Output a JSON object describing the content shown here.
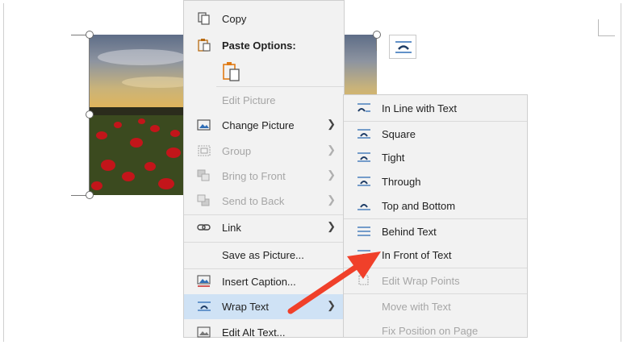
{
  "context_menu": {
    "items": [
      {
        "label": "Copy",
        "icon": "copy-icon",
        "enabled": true
      },
      {
        "label": "Paste Options:",
        "icon": "paste-icon",
        "enabled": true,
        "bold": true
      },
      {
        "label": "Edit Picture",
        "enabled": false
      },
      {
        "label": "Change Picture",
        "icon": "change-picture-icon",
        "enabled": true,
        "submenu": true
      },
      {
        "label": "Group",
        "icon": "group-icon",
        "enabled": false,
        "submenu": true
      },
      {
        "label": "Bring to Front",
        "icon": "bring-to-front-icon",
        "enabled": false,
        "submenu": true
      },
      {
        "label": "Send to Back",
        "icon": "send-to-back-icon",
        "enabled": false,
        "submenu": true
      },
      {
        "label": "Link",
        "icon": "link-icon",
        "enabled": true,
        "submenu": true
      },
      {
        "label": "Save as Picture...",
        "enabled": true
      },
      {
        "label": "Insert Caption...",
        "icon": "insert-caption-icon",
        "enabled": true
      },
      {
        "label": "Wrap Text",
        "icon": "wrap-text-icon",
        "enabled": true,
        "submenu": true,
        "highlighted": true
      },
      {
        "label": "Edit Alt Text...",
        "icon": "alt-text-icon",
        "enabled": true
      }
    ]
  },
  "wrap_submenu": {
    "items": [
      {
        "label": "In Line with Text",
        "icon": "inline-with-text-icon",
        "enabled": true
      },
      {
        "label": "Square",
        "icon": "square-wrap-icon",
        "enabled": true
      },
      {
        "label": "Tight",
        "icon": "tight-wrap-icon",
        "enabled": true
      },
      {
        "label": "Through",
        "icon": "through-wrap-icon",
        "enabled": true
      },
      {
        "label": "Top and Bottom",
        "icon": "top-bottom-wrap-icon",
        "enabled": true
      },
      {
        "label": "Behind Text",
        "icon": "behind-text-icon",
        "enabled": true
      },
      {
        "label": "In Front of Text",
        "icon": "in-front-of-text-icon",
        "enabled": true
      },
      {
        "label": "Edit Wrap Points",
        "icon": "edit-wrap-points-icon",
        "enabled": false
      },
      {
        "label": "Move with Text",
        "enabled": false
      },
      {
        "label": "Fix Position on Page",
        "enabled": false
      }
    ]
  },
  "colors": {
    "menu_bg": "#f2f2f2",
    "highlight": "#cfe2f5",
    "disabled_text": "#a6a6a6",
    "annotation_arrow": "#f0402a",
    "icon_blue": "#2f6db5"
  }
}
